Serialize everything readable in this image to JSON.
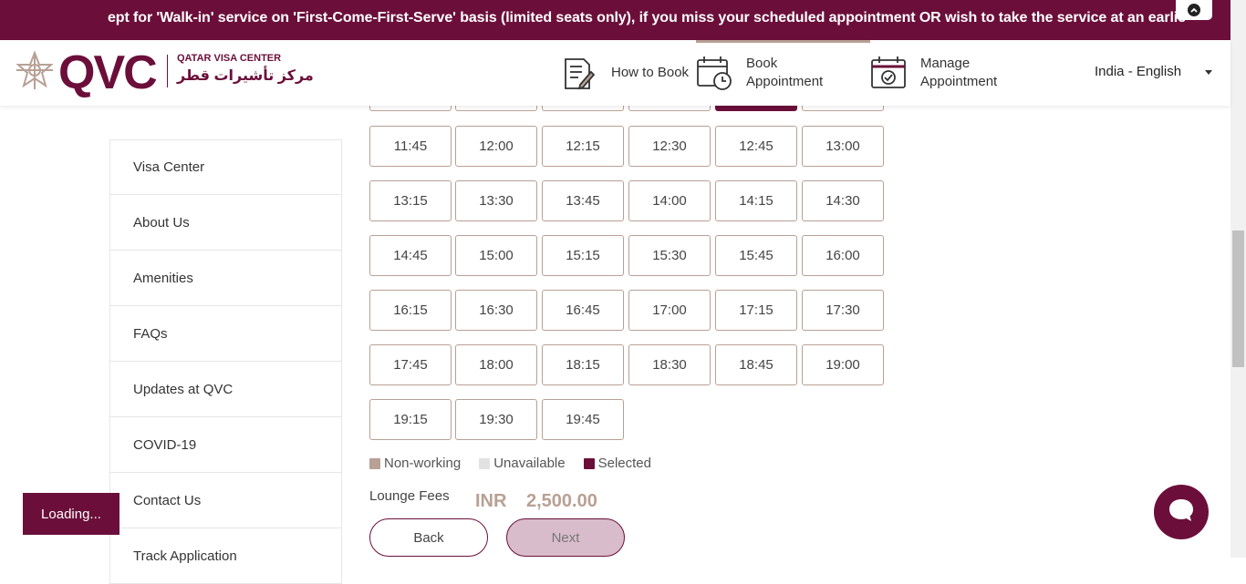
{
  "ticker": {
    "text": "ept for 'Walk-in' service on 'First-Come-First-Serve' basis (limited seats only), if you miss your scheduled appointment OR wish to take the service at an earlie"
  },
  "header": {
    "logo_text": "QVC",
    "logo_en": "QATAR VISA CENTER",
    "logo_ar": "مركز تأشيرات قطر",
    "nav": [
      {
        "label": "How to Book",
        "icon": "document-pen-icon"
      },
      {
        "label": "Book Appointment",
        "icon": "calendar-clock-icon"
      },
      {
        "label": "Manage Appointment",
        "icon": "calendar-check-icon"
      }
    ],
    "language": "India - English"
  },
  "side_menu": [
    "Visa Center",
    "About Us",
    "Amenities",
    "FAQs",
    "Updates at QVC",
    "COVID-19",
    "Contact Us",
    "Track Application"
  ],
  "slots": [
    [
      "11:45",
      "12:00",
      "12:15",
      "12:30",
      "12:45",
      "13:00"
    ],
    [
      "13:15",
      "13:30",
      "13:45",
      "14:00",
      "14:15",
      "14:30"
    ],
    [
      "14:45",
      "15:00",
      "15:15",
      "15:30",
      "15:45",
      "16:00"
    ],
    [
      "16:15",
      "16:30",
      "16:45",
      "17:00",
      "17:15",
      "17:30"
    ],
    [
      "17:45",
      "18:00",
      "18:15",
      "18:30",
      "18:45",
      "19:00"
    ],
    [
      "19:15",
      "19:30",
      "19:45"
    ]
  ],
  "legend": [
    {
      "label": "Non-working",
      "color": "#b8a095"
    },
    {
      "label": "Unavailable",
      "color": "#e2e2e2"
    },
    {
      "label": "Selected",
      "color": "#6b0f3a"
    }
  ],
  "fees": {
    "label": "Lounge Fees",
    "currency": "INR",
    "amount": "2,500.00"
  },
  "buttons": {
    "back": "Back",
    "next": "Next"
  },
  "loading": "Loading...",
  "colors": {
    "brand": "#6b0f3a",
    "accent": "#b8a095"
  }
}
